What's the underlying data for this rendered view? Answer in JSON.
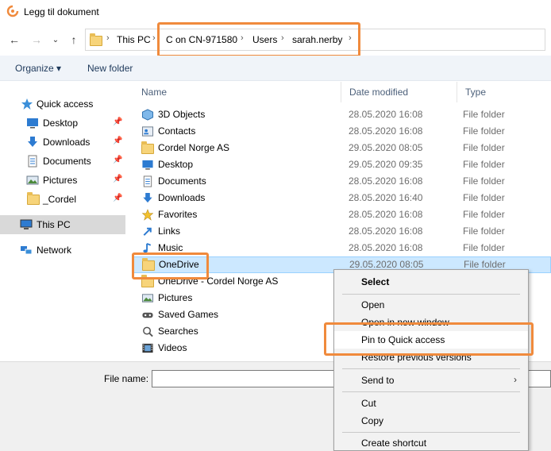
{
  "window": {
    "title": "Legg til dokument"
  },
  "address": {
    "breadcrumbs": [
      "This PC",
      "C on CN-971580",
      "Users",
      "sarah.nerby"
    ]
  },
  "toolbar": {
    "organize": "Organize ▾",
    "new_folder": "New folder"
  },
  "sidebar": {
    "items": [
      {
        "label": "Quick access",
        "icon": "quick-access-star-icon"
      },
      {
        "label": "Desktop",
        "icon": "desktop-icon",
        "pinned": true
      },
      {
        "label": "Downloads",
        "icon": "downloads-arrow-icon",
        "pinned": true
      },
      {
        "label": "Documents",
        "icon": "documents-icon",
        "pinned": true
      },
      {
        "label": "Pictures",
        "icon": "pictures-icon",
        "pinned": true
      },
      {
        "label": "_Cordel",
        "icon": "folder-icon",
        "pinned": true
      },
      {
        "label": "This PC",
        "icon": "computer-icon",
        "selected": true
      },
      {
        "label": "Network",
        "icon": "network-icon"
      }
    ]
  },
  "filelist": {
    "columns": {
      "name": "Name",
      "date": "Date modified",
      "type": "Type"
    },
    "rows": [
      {
        "name": "3D Objects",
        "date": "28.05.2020 16:08",
        "type": "File folder",
        "icon": "3d-objects-icon"
      },
      {
        "name": "Contacts",
        "date": "28.05.2020 16:08",
        "type": "File folder",
        "icon": "contacts-icon"
      },
      {
        "name": "Cordel Norge AS",
        "date": "29.05.2020 08:05",
        "type": "File folder",
        "icon": "folder-icon"
      },
      {
        "name": "Desktop",
        "date": "29.05.2020 09:35",
        "type": "File folder",
        "icon": "desktop-icon"
      },
      {
        "name": "Documents",
        "date": "28.05.2020 16:08",
        "type": "File folder",
        "icon": "documents-icon"
      },
      {
        "name": "Downloads",
        "date": "28.05.2020 16:40",
        "type": "File folder",
        "icon": "downloads-arrow-icon"
      },
      {
        "name": "Favorites",
        "date": "28.05.2020 16:08",
        "type": "File folder",
        "icon": "favorites-star-icon"
      },
      {
        "name": "Links",
        "date": "28.05.2020 16:08",
        "type": "File folder",
        "icon": "links-icon"
      },
      {
        "name": "Music",
        "date": "28.05.2020 16:08",
        "type": "File folder",
        "icon": "music-icon"
      },
      {
        "name": "OneDrive",
        "date": "29.05.2020 08:05",
        "type": "File folder",
        "icon": "folder-icon",
        "selected": true
      },
      {
        "name": "OneDrive - Cordel Norge AS",
        "date": "",
        "type": "",
        "icon": "folder-icon"
      },
      {
        "name": "Pictures",
        "date": "",
        "type": "",
        "icon": "pictures-icon"
      },
      {
        "name": "Saved Games",
        "date": "",
        "type": "",
        "icon": "saved-games-icon"
      },
      {
        "name": "Searches",
        "date": "",
        "type": "",
        "icon": "search-icon"
      },
      {
        "name": "Videos",
        "date": "",
        "type": "",
        "icon": "videos-icon"
      }
    ]
  },
  "bottom": {
    "file_name_label": "File name:",
    "file_name_value": ""
  },
  "context_menu": {
    "items": [
      {
        "label": "Select",
        "bold": true
      },
      {
        "separator": true
      },
      {
        "label": "Open"
      },
      {
        "label": "Open in new window"
      },
      {
        "label": "Pin to Quick access",
        "hover": true
      },
      {
        "label": "Restore previous versions"
      },
      {
        "separator": true
      },
      {
        "label": "Send to",
        "submenu": true
      },
      {
        "separator": true
      },
      {
        "label": "Cut"
      },
      {
        "label": "Copy"
      },
      {
        "separator": true
      },
      {
        "label": "Create shortcut"
      }
    ]
  },
  "colors": {
    "highlight": "#f08a3c",
    "selection": "#cce8ff",
    "toolbar_bg": "#f0f4f9"
  }
}
